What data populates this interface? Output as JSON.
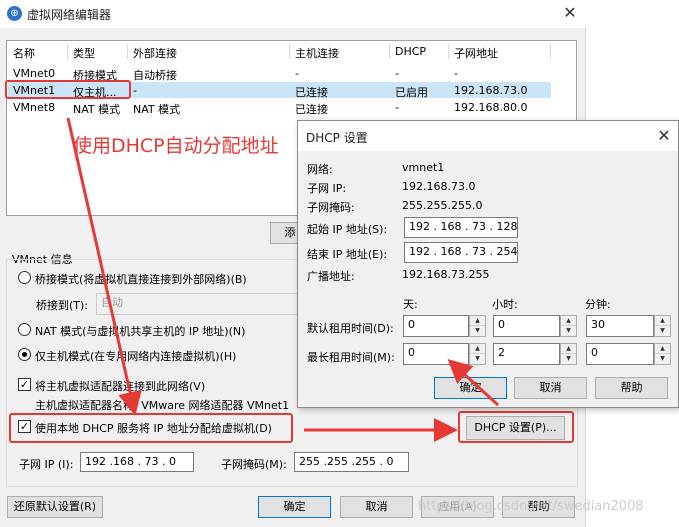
{
  "main_window": {
    "title": "虚拟网络编辑器",
    "columns": [
      "名称",
      "类型",
      "外部连接",
      "主机连接",
      "DHCP",
      "子网地址"
    ],
    "rows": [
      {
        "name": "VMnet0",
        "type": "桥接模式",
        "external": "自动桥接",
        "host": "-",
        "dhcp": "-",
        "subnet": "-"
      },
      {
        "name": "VMnet1",
        "type": "仅主机...",
        "external": "-",
        "host": "已连接",
        "dhcp": "已启用",
        "subnet": "192.168.73.0"
      },
      {
        "name": "VMnet8",
        "type": "NAT 模式",
        "external": "NAT 模式",
        "host": "已连接",
        "dhcp": "-",
        "subnet": "192.168.80.0"
      }
    ],
    "add_button": "添",
    "vmnet_info_label": "VMnet 信息",
    "bridge_mode_label": "桥接模式(将虚拟机直接连接到外部网络)(B)",
    "bridge_to_label": "桥接到(T):",
    "bridge_to_value": "自动",
    "nat_mode_label": "NAT 模式(与虚拟机共享主机的 IP 地址)(N)",
    "host_only_label": "仅主机模式(在专用网络内连接虚拟机)(H)",
    "connect_adapter_label": "将主机虚拟适配器连接到此网络(V)",
    "adapter_name_label": "主机虚拟适配器名称: VMware 网络适配器 VMnet1",
    "use_dhcp_label": "使用本地 DHCP 服务将 IP 地址分配给虚拟机(D)",
    "dhcp_settings_button": "DHCP 设置(P)...",
    "subnet_ip_label": "子网 IP (I):",
    "subnet_ip_value": "192 .168 . 73 . 0",
    "subnet_mask_label": "子网掩码(M):",
    "subnet_mask_value": "255 .255 .255 . 0",
    "restore_defaults_button": "还原默认设置(R)",
    "ok_button": "确定",
    "cancel_button": "取消",
    "apply_button": "应用(A)",
    "help_button": "帮助"
  },
  "annotation": {
    "text": "使用DHCP自动分配地址",
    "color": "#e53935"
  },
  "dhcp_dialog": {
    "title": "DHCP 设置",
    "network_label": "网络:",
    "network_value": "vmnet1",
    "subnet_ip_label": "子网 IP:",
    "subnet_ip_value": "192.168.73.0",
    "subnet_mask_label": "子网掩码:",
    "subnet_mask_value": "255.255.255.0",
    "start_ip_label": "起始 IP 地址(S):",
    "start_ip_value": "192 . 168 . 73 . 128",
    "end_ip_label": "结束 IP 地址(E):",
    "end_ip_value": "192 . 168 . 73 . 254",
    "broadcast_label": "广播地址:",
    "broadcast_value": "192.168.73.255",
    "days_header": "天:",
    "hours_header": "小时:",
    "minutes_header": "分钟:",
    "default_lease_label": "默认租用时间(D):",
    "default_lease": {
      "days": "0",
      "hours": "0",
      "minutes": "30"
    },
    "max_lease_label": "最长租用时间(M):",
    "max_lease": {
      "days": "0",
      "hours": "2",
      "minutes": "0"
    },
    "ok_button": "确定",
    "cancel_button": "取消",
    "help_button": "帮助"
  },
  "watermark": "https://blog.csdn.net/swedian2008"
}
